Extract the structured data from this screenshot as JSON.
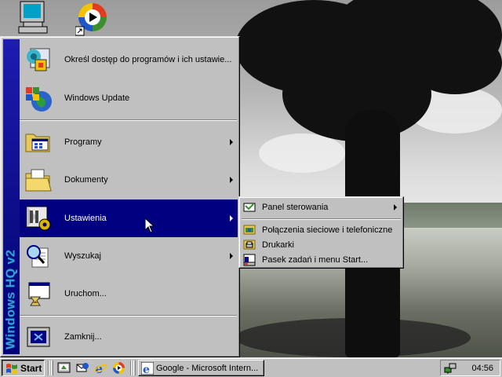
{
  "start_menu": {
    "sidebar_text": "Windows HQ v2",
    "items": [
      {
        "label": "Określ dostęp do programów i ich ustawie...",
        "icon": "set-program-access-icon",
        "submenu": false
      },
      {
        "label": "Windows Update",
        "icon": "windows-update-icon",
        "submenu": false
      },
      {
        "label": "Programy",
        "icon": "programs-icon",
        "submenu": true
      },
      {
        "label": "Dokumenty",
        "icon": "documents-icon",
        "submenu": true
      },
      {
        "label": "Ustawienia",
        "icon": "settings-icon",
        "submenu": true,
        "highlighted": true
      },
      {
        "label": "Wyszukaj",
        "icon": "search-icon",
        "submenu": true
      },
      {
        "label": "Uruchom...",
        "icon": "run-icon",
        "submenu": false
      },
      {
        "label": "Zamknij...",
        "icon": "shutdown-icon",
        "submenu": false
      }
    ]
  },
  "settings_submenu": {
    "items": [
      {
        "label": "Panel sterowania",
        "icon": "control-panel-icon",
        "submenu": true
      },
      {
        "label": "Połączenia sieciowe i telefoniczne",
        "icon": "network-connections-icon",
        "submenu": false
      },
      {
        "label": "Drukarki",
        "icon": "printers-icon",
        "submenu": false
      },
      {
        "label": "Pasek zadań i menu Start...",
        "icon": "taskbar-icon",
        "submenu": false
      }
    ]
  },
  "taskbar": {
    "start_label": "Start",
    "quick_launch": [
      "show-desktop-icon",
      "outlook-express-icon",
      "internet-explorer-icon",
      "media-player-icon"
    ],
    "task_button_label": "Google - Microsoft Intern...",
    "clock": "04:56"
  },
  "colors": {
    "menu_bg": "#c0c0c0",
    "highlight": "#000080",
    "sidebar_text": "#37a2d9"
  }
}
